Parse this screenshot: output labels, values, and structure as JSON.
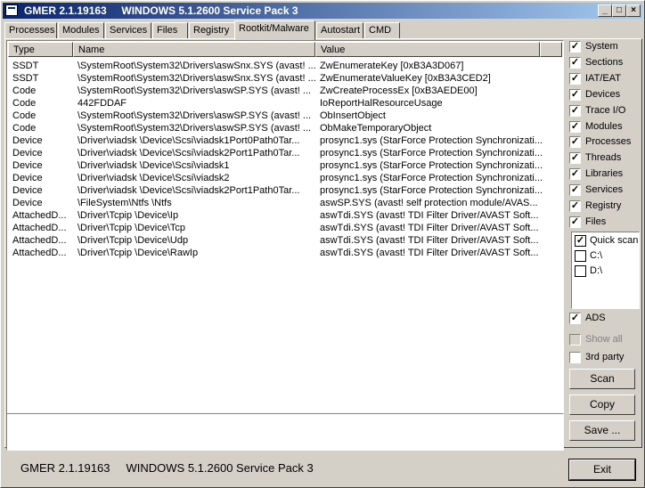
{
  "window": {
    "title": "GMER 2.1.19163     WINDOWS 5.1.2600 Service Pack 3"
  },
  "title_buttons": {
    "minimize": "_",
    "maximize": "□",
    "close": "×"
  },
  "tabs": [
    {
      "label": "Processes"
    },
    {
      "label": "Modules"
    },
    {
      "label": "Services"
    },
    {
      "label": "Files"
    },
    {
      "label": "Registry"
    },
    {
      "label": "Rootkit/Malware",
      "active": true
    },
    {
      "label": "Autostart"
    },
    {
      "label": "CMD"
    }
  ],
  "list": {
    "columns": [
      "Type",
      "Name",
      "Value"
    ],
    "rows": [
      [
        "SSDT",
        "\\SystemRoot\\System32\\Drivers\\aswSnx.SYS (avast! ...",
        "ZwEnumerateKey [0xB3A3D067]"
      ],
      [
        "SSDT",
        "\\SystemRoot\\System32\\Drivers\\aswSnx.SYS (avast! ...",
        "ZwEnumerateValueKey [0xB3A3CED2]"
      ],
      [
        "Code",
        "\\SystemRoot\\System32\\Drivers\\aswSP.SYS (avast! ...",
        "ZwCreateProcessEx [0xB3AEDE00]"
      ],
      [
        "Code",
        "442FDDAF",
        "IoReportHalResourceUsage"
      ],
      [
        "Code",
        "\\SystemRoot\\System32\\Drivers\\aswSP.SYS (avast! ...",
        "ObInsertObject"
      ],
      [
        "Code",
        "\\SystemRoot\\System32\\Drivers\\aswSP.SYS (avast! ...",
        "ObMakeTemporaryObject"
      ],
      [
        "Device",
        "\\Driver\\viadsk \\Device\\Scsi\\viadsk1Port0Path0Tar...",
        "prosync1.sys (StarForce Protection Synchronizati..."
      ],
      [
        "Device",
        "\\Driver\\viadsk \\Device\\Scsi\\viadsk2Port1Path0Tar...",
        "prosync1.sys (StarForce Protection Synchronizati..."
      ],
      [
        "Device",
        "\\Driver\\viadsk \\Device\\Scsi\\viadsk1",
        "prosync1.sys (StarForce Protection Synchronizati..."
      ],
      [
        "Device",
        "\\Driver\\viadsk \\Device\\Scsi\\viadsk2",
        "prosync1.sys (StarForce Protection Synchronizati..."
      ],
      [
        "Device",
        "\\Driver\\viadsk \\Device\\Scsi\\viadsk2Port1Path0Tar...",
        "prosync1.sys (StarForce Protection Synchronizati..."
      ],
      [
        "Device",
        "\\FileSystem\\Ntfs \\Ntfs",
        "aswSP.SYS (avast! self protection module/AVAS..."
      ],
      [
        "AttachedD...",
        "\\Driver\\Tcpip \\Device\\Ip",
        "aswTdi.SYS (avast! TDI Filter Driver/AVAST Soft..."
      ],
      [
        "AttachedD...",
        "\\Driver\\Tcpip \\Device\\Tcp",
        "aswTdi.SYS (avast! TDI Filter Driver/AVAST Soft..."
      ],
      [
        "AttachedD...",
        "\\Driver\\Tcpip \\Device\\Udp",
        "aswTdi.SYS (avast! TDI Filter Driver/AVAST Soft..."
      ],
      [
        "AttachedD...",
        "\\Driver\\Tcpip \\Device\\RawIp",
        "aswTdi.SYS (avast! TDI Filter Driver/AVAST Soft..."
      ]
    ]
  },
  "scan_options": [
    {
      "label": "System",
      "checked": true
    },
    {
      "label": "Sections",
      "checked": true
    },
    {
      "label": "IAT/EAT",
      "checked": true
    },
    {
      "label": "Devices",
      "checked": true
    },
    {
      "label": "Trace I/O",
      "checked": true
    },
    {
      "label": "Modules",
      "checked": true
    },
    {
      "label": "Processes",
      "checked": true
    },
    {
      "label": "Threads",
      "checked": true
    },
    {
      "label": "Libraries",
      "checked": true
    },
    {
      "label": "Services",
      "checked": true
    },
    {
      "label": "Registry",
      "checked": true
    },
    {
      "label": "Files",
      "checked": true
    }
  ],
  "drives": [
    {
      "label": "Quick scan",
      "checked": true
    },
    {
      "label": "C:\\",
      "checked": false
    },
    {
      "label": "D:\\",
      "checked": false
    }
  ],
  "extra_options": [
    {
      "label": "ADS",
      "checked": true,
      "disabled": false
    },
    {
      "label": "Show all",
      "checked": false,
      "disabled": true
    },
    {
      "label": "3rd party",
      "checked": false,
      "disabled": false
    }
  ],
  "buttons": {
    "scan": "Scan",
    "copy": "Copy",
    "save": "Save ...",
    "exit": "Exit"
  },
  "status": {
    "text": "GMER 2.1.19163     WINDOWS 5.1.2600 Service Pack 3"
  }
}
